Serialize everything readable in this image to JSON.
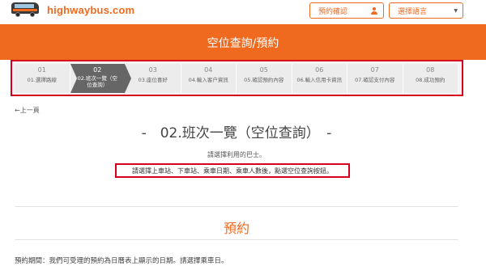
{
  "header": {
    "logo_text": "highwaybus.com",
    "reserve_button": "預約確認",
    "language_select": "選擇語言",
    "brand_color": "#ef6a1e"
  },
  "banner": {
    "title": "空位查詢/預約"
  },
  "steps": [
    {
      "num": "01",
      "label": "01.選擇路線"
    },
    {
      "num": "02",
      "label": "02.班次一覽（空位查詢）"
    },
    {
      "num": "03",
      "label": "03.座位喜好"
    },
    {
      "num": "04",
      "label": "04.輸入客户資訊"
    },
    {
      "num": "05",
      "label": "05.確認預約內容"
    },
    {
      "num": "06",
      "label": "06.輸入信用卡資訊"
    },
    {
      "num": "07",
      "label": "07.確認支付內容"
    },
    {
      "num": "08",
      "label": "08.成功預約"
    }
  ],
  "active_step": 2,
  "back_link": "上一頁",
  "page_title": "-　02.班次一覽（空位查詢）　-",
  "instructions": {
    "line1": "請選擇利用的巴士。",
    "line2": "請選擇上車站、下車站、乘車日期、乘車人數後，點選空位查詢按鈕。"
  },
  "section": {
    "title": "預約",
    "period_note": "預約期間：我們可受理的預約為日曆表上顯示的日期。請選擇乘車日。"
  }
}
